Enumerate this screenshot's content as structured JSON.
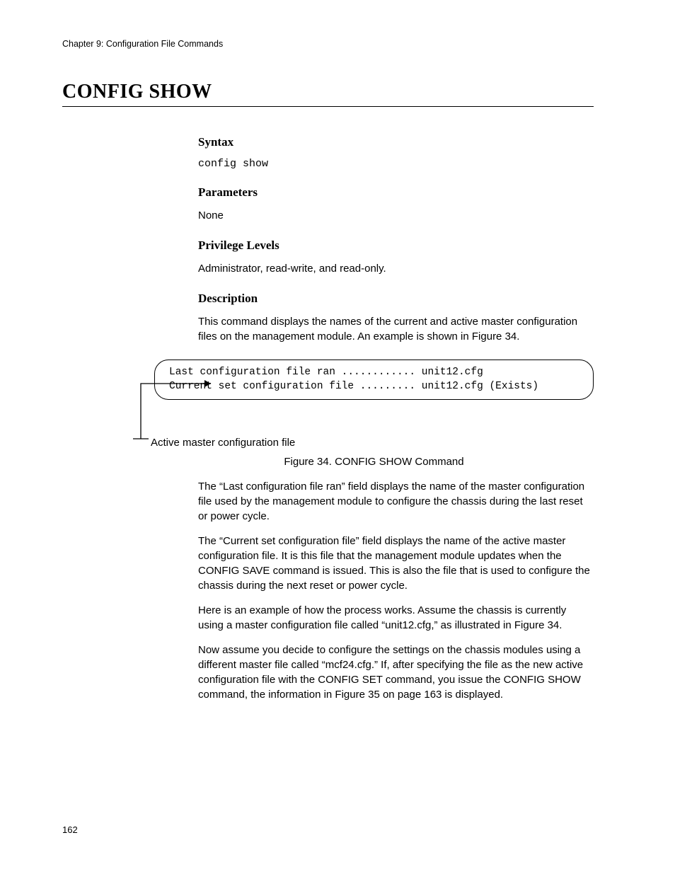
{
  "header": {
    "chapter": "Chapter 9: Configuration File Commands"
  },
  "title": "CONFIG SHOW",
  "sections": {
    "syntax": {
      "heading": "Syntax",
      "code": "config show"
    },
    "parameters": {
      "heading": "Parameters",
      "text": "None"
    },
    "privilege": {
      "heading": "Privilege Levels",
      "text": "Administrator, read-write, and read-only."
    },
    "description": {
      "heading": "Description",
      "intro": "This command displays the names of the current and active master configuration files on the management module. An example is shown in Figure 34."
    }
  },
  "terminal": {
    "line1": "Last configuration file ran ............ unit12.cfg",
    "line2": "Current set configuration file ......... unit12.cfg (Exists)"
  },
  "callout": {
    "label": "Active master configuration file"
  },
  "figure_caption": "Figure 34. CONFIG SHOW Command",
  "paragraphs": {
    "p1": "The “Last configuration file ran” field displays the name of the master configuration file used by the management module to configure the chassis during the last reset or power cycle.",
    "p2": "The “Current set configuration file” field displays the name of the active master configuration file. It is this file that the management module updates when the CONFIG SAVE command is issued. This is also the file that is used to configure the chassis during the next reset or power cycle.",
    "p3": "Here is an example of how the process works. Assume the chassis is currently using a master configuration file called “unit12.cfg,” as illustrated in Figure 34.",
    "p4": "Now assume you decide to configure the settings on the chassis modules using a different master file called “mcf24.cfg.” If, after specifying the file as the new active configuration file with the CONFIG SET command, you issue the CONFIG SHOW command, the information in Figure 35 on page 163 is displayed."
  },
  "page_number": "162"
}
